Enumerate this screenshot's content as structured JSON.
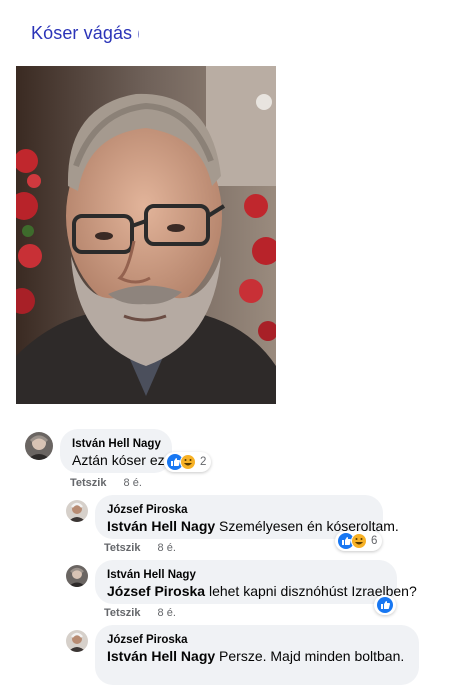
{
  "post": {
    "title": "Kóser vágás ("
  },
  "comments": [
    {
      "author": "István Hell Nagy",
      "mention": "",
      "text": "Aztán kóser ez?",
      "like_label": "Tetszik",
      "time": "8 é.",
      "reaction_count": "2"
    },
    {
      "author": "József Piroska",
      "mention": "István Hell Nagy",
      "text": " Személyesen én kóseroltam.",
      "like_label": "Tetszik",
      "time": "8 é.",
      "reaction_count": "6"
    },
    {
      "author": "István Hell Nagy",
      "mention": "József Piroska",
      "text": " lehet kapni disznóhúst Izraelben?",
      "like_label": "Tetszik",
      "time": "8 é.",
      "reaction_count": ""
    },
    {
      "author": "József Piroska",
      "mention": "István Hell Nagy",
      "text": " Persze. Majd minden boltban.",
      "like_label": "",
      "time": "",
      "reaction_count": ""
    }
  ],
  "icons": {
    "like": "like-reaction-icon",
    "haha": "haha-reaction-icon"
  },
  "colors": {
    "title": "#2b34b8",
    "bubble": "#f0f2f5",
    "like_blue": "#1877f2",
    "haha_yellow": "#f7b125"
  }
}
